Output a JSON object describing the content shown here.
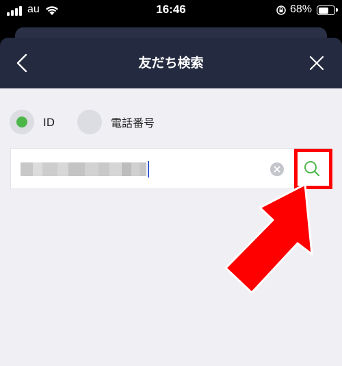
{
  "status_bar": {
    "carrier": "au",
    "time": "16:46",
    "battery": "68%",
    "battery_level": 0.68
  },
  "nav": {
    "title": "友だち検索",
    "back_icon": "chevron-left-icon",
    "close_icon": "close-icon"
  },
  "search_type": {
    "options": [
      {
        "label": "ID",
        "selected": true
      },
      {
        "label": "電話番号",
        "selected": false
      }
    ]
  },
  "search": {
    "value_obscured": true,
    "clear_icon": "clear-icon",
    "search_icon": "search-icon"
  },
  "colors": {
    "nav_bg": "#242b40",
    "selected_radio": "#4cb748",
    "search_icon": "#4cb748",
    "highlight": "#ff0000",
    "caret": "#3a5bd6"
  }
}
